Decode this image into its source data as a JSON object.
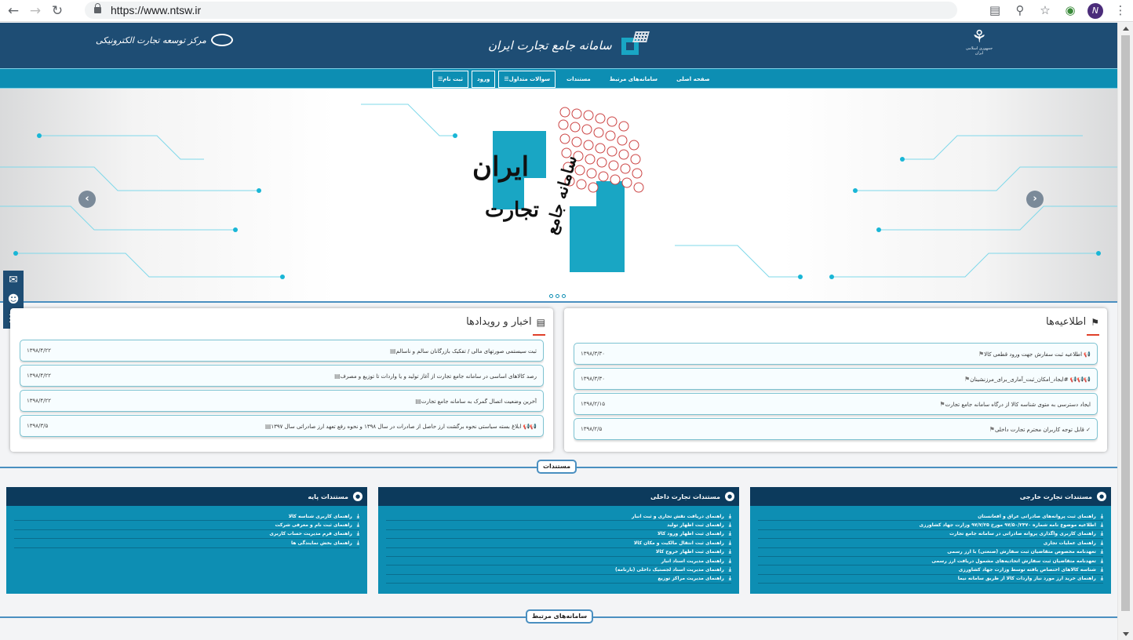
{
  "browser": {
    "url": "https://www.ntsw.ir",
    "profile_initial": "N",
    "icons": [
      "back-icon",
      "forward-icon",
      "reload-icon",
      "translate-icon",
      "zoom-icon",
      "star-icon",
      "extension-icon",
      "profile-avatar",
      "menu-icon"
    ]
  },
  "header": {
    "brand_title": "سامانه جامع تجارت ایران",
    "ecenter_label": "مرکز توسعه تجارت الکترونیکی",
    "emblem_sub": "جمهوری اسلامی ایران"
  },
  "nav": {
    "items": [
      "صفحه اصلی",
      "سامانه‌های مرتبط",
      "مستندات",
      "☰سوالات متداول",
      "ورود",
      "☰ثبت نام"
    ]
  },
  "slider": {
    "hero_title_1": "ایران",
    "hero_title_2": "تجارت",
    "hero_title_3": "سامانه جامع",
    "prev": "‹",
    "next": "›"
  },
  "news": {
    "title": "اخبار و رویدادها",
    "items": [
      {
        "text": "ثبت سیستمی صورتهای مالی / تفکیک بازرگانان سالم و ناسالم",
        "date": "۱۳۹۸/۴/۲۲"
      },
      {
        "text": "رصد کالاهای اساسی در سامانه جامع تجارت از آغاز تولید و یا واردات تا توزیع و مصرف",
        "date": "۱۳۹۸/۴/۲۲"
      },
      {
        "text": "آخرین وضعیت اتصال گمرک به سامانه جامع تجارت",
        "date": "۱۳۹۸/۴/۲۲"
      },
      {
        "text": "📢📢 ابلاغ بسته سیاستی نحوه برگشت ارز حاصل از صادرات در سال ۱۳۹۸ و نحوه رفع تعهد ارز صادراتی سال ۱۳۹۷",
        "date": "۱۳۹۸/۳/۵"
      }
    ]
  },
  "notices": {
    "title": "اطلاعیه‌ها",
    "items": [
      {
        "text": "📢 اطلاعیه ثبت سفارش جهت ورود قطعی کالا",
        "date": "۱۳۹۸/۳/۳۰"
      },
      {
        "text": "📢📢📢 #ایجاد_امکان_ثبت_آماری_برای_مرزنشینان",
        "date": "۱۳۹۸/۳/۳۰"
      },
      {
        "text": "ایجاد دسترسی به متوی شناسه کالا از درگاه سامانه جامع تجارت",
        "date": "۱۳۹۸/۲/۱۵"
      },
      {
        "text": "✓ قابل توجه کاربران محترم تجارت داخلی",
        "date": "۱۳۹۸/۲/۵"
      }
    ]
  },
  "sections": {
    "documents": "مستندات",
    "related": "سامانه‌های مرتبط"
  },
  "docs": {
    "base": {
      "title": "مستندات پایه",
      "items": [
        "راهنمای کاربری شناسه کالا",
        "راهنمای ثبت نام و معرفی شرکت",
        "راهنمای فرم مدیریت حساب کاربری",
        "راهنمای بخش نمایندگی ها"
      ]
    },
    "domestic": {
      "title": "مستندات تجارت داخلی",
      "items": [
        "راهنمای دریافت نقش تجاری و ثبت انبار",
        "راهنمای ثبت اظهار تولید",
        "راهنمای ثبت اظهار ورود کالا",
        "راهنمای ثبت انتقال مالکیت و مکان کالا",
        "راهنمای ثبت اظهار خروج کالا",
        "راهنمای مدیریت اسناد انبار",
        "راهنمای مدیریت اسناد لجستیک داخلی (بارنامه)",
        "راهنمای مدیریت مراکز توزیع"
      ]
    },
    "foreign": {
      "title": "مستندات تجارت خارجی",
      "items": [
        "راهنمای ثبت پروانه‌های صادراتی عراق و افغانستان",
        "اطلاعیه موضوع نامه شماره ۹۷/۵۰/۲۴۷۰ مورخ ۹۷/۷/۲۵ وزارت جهاد کشاورزی",
        "راهنمای کاربری واگذاری پروانه صادراتی در سامانه جامع تجارت",
        "راهنمای عملیات تجاری",
        "تعهدنامه مخصوص متقاضیان ثبت سفارش (صنعتی) با ارز رسمی",
        "تعهدنامه متقاضیان ثبت سفارش اتحادیه‌های مشمول دریافت ارز رسمی",
        "شناسه کالاهای اختصاص یافته توسط وزارت جهاد کشاورزی",
        "راهنمای خرید ارز مورد نیاز واردات کالا از طریق سامانه نیما"
      ]
    }
  },
  "colors": {
    "header": "#1e4d74",
    "nav": "#0d8eb3",
    "accent": "#e0402a",
    "doc_header": "#0c3a5c"
  }
}
